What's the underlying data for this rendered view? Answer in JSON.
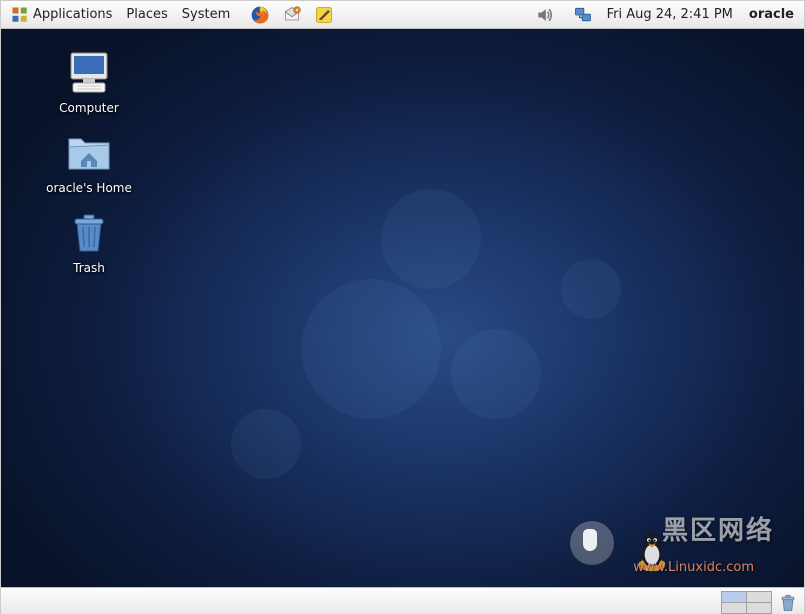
{
  "panel": {
    "menus": {
      "applications": "Applications",
      "places": "Places",
      "system": "System"
    },
    "datetime": "Fri Aug 24,  2:41 PM",
    "user": "oracle"
  },
  "desktop": {
    "icons": {
      "computer": {
        "label": "Computer"
      },
      "home": {
        "label": "oracle's Home"
      },
      "trash": {
        "label": "Trash"
      }
    }
  },
  "watermark": {
    "text_main": "黑区网络",
    "text_url": "www.Linuxidc.com"
  }
}
